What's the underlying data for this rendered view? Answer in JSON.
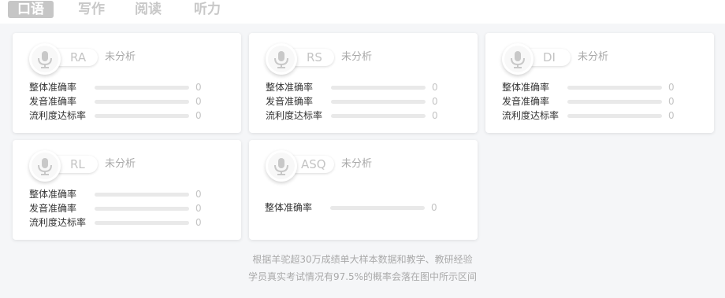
{
  "tabs": [
    {
      "label": "口语",
      "active": true
    },
    {
      "label": "写作",
      "active": false
    },
    {
      "label": "阅读",
      "active": false
    },
    {
      "label": "听力",
      "active": false
    }
  ],
  "cards": [
    {
      "code": "RA",
      "status": "未分析",
      "metrics": [
        {
          "label": "整体准确率",
          "value": "0",
          "progress": 0
        },
        {
          "label": "发音准确率",
          "value": "0",
          "progress": 0
        },
        {
          "label": "流利度达标率",
          "value": "0",
          "progress": 0
        }
      ]
    },
    {
      "code": "RS",
      "status": "未分析",
      "metrics": [
        {
          "label": "整体准确率",
          "value": "0",
          "progress": 0
        },
        {
          "label": "发音准确率",
          "value": "0",
          "progress": 0
        },
        {
          "label": "流利度达标率",
          "value": "0",
          "progress": 0
        }
      ]
    },
    {
      "code": "DI",
      "status": "未分析",
      "metrics": [
        {
          "label": "整体准确率",
          "value": "0",
          "progress": 0
        },
        {
          "label": "发音准确率",
          "value": "0",
          "progress": 0
        },
        {
          "label": "流利度达标率",
          "value": "0",
          "progress": 0
        }
      ]
    },
    {
      "code": "RL",
      "status": "未分析",
      "metrics": [
        {
          "label": "整体准确率",
          "value": "0",
          "progress": 0
        },
        {
          "label": "发音准确率",
          "value": "0",
          "progress": 0
        },
        {
          "label": "流利度达标率",
          "value": "0",
          "progress": 0
        }
      ]
    },
    {
      "code": "ASQ",
      "status": "未分析",
      "metrics": [
        {
          "label": "整体准确率",
          "value": "0",
          "progress": 0
        }
      ]
    }
  ],
  "footer": {
    "line1": "根据羊驼超30万成绩单大样本数据和教学、教研经验",
    "line2": "学员真实考试情况有97.5%的概率会落在图中所示区间"
  },
  "colors": {
    "background": "#f5f6f8",
    "active_tab": "#c6c6c6",
    "inactive_tab": "#c8c8c8",
    "track": "#e9e9e9"
  },
  "icons": {
    "card_icon": "microphone-icon"
  }
}
